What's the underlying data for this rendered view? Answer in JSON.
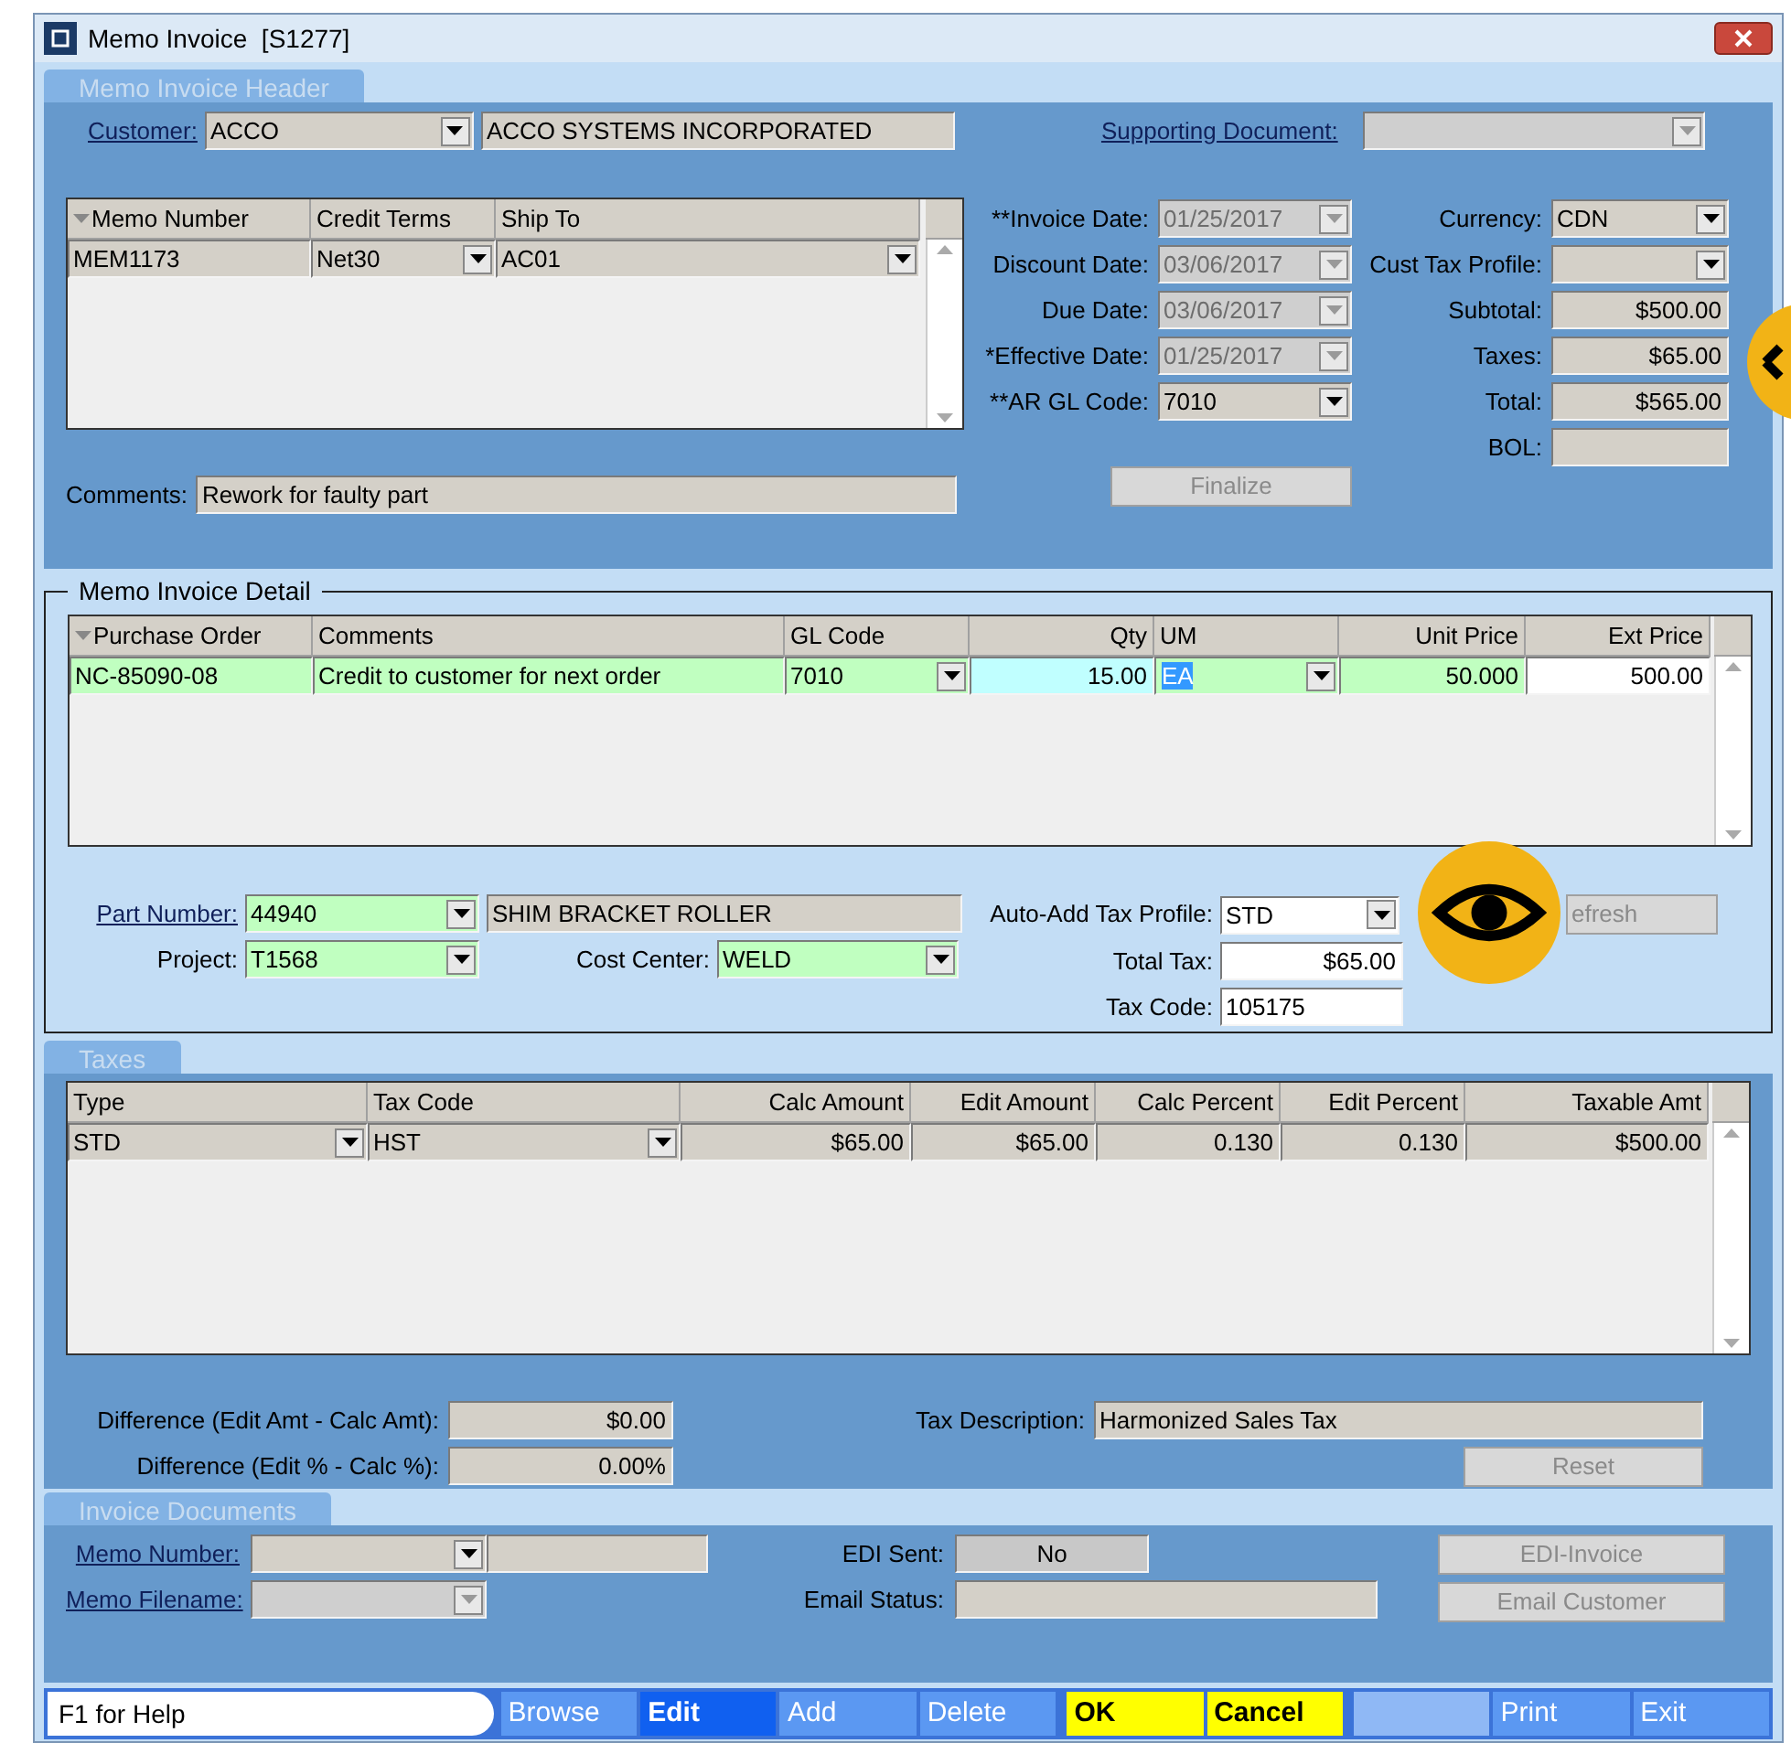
{
  "window": {
    "title": "Memo Invoice  [S1277]"
  },
  "header": {
    "title": "Memo Invoice Header",
    "customer": {
      "label": "Customer:",
      "link": true,
      "code": "ACCO",
      "name": "ACCO SYSTEMS INCORPORATED"
    },
    "supporting_document": {
      "label": "Supporting Document:",
      "link": true,
      "disabled": true
    },
    "memo_grid": {
      "columns": [
        {
          "label": "Memo Number",
          "kind": "text",
          "sort": true
        },
        {
          "label": "Credit Terms",
          "kind": "dropdown",
          "sort": false
        },
        {
          "label": "Ship To",
          "kind": "dropdown",
          "sort": false
        }
      ],
      "rows": [
        [
          "MEM1173",
          "Net30",
          "AC01"
        ]
      ]
    },
    "date_fields": [
      {
        "label": "**Invoice Date:",
        "value": "01/25/2017",
        "disabled": true
      },
      {
        "label": "Discount Date:",
        "value": "03/06/2017",
        "disabled": true
      },
      {
        "label": "Due Date:",
        "value": "03/06/2017",
        "disabled": true
      },
      {
        "label": "*Effective Date:",
        "value": "01/25/2017",
        "disabled": true
      },
      {
        "label": "**AR GL Code:",
        "value": "7010",
        "disabled": false
      }
    ],
    "totals": [
      {
        "label": "Currency:",
        "value": "CDN",
        "kind": "dropdown"
      },
      {
        "label": "Cust Tax Profile:",
        "kind": "dropdown"
      },
      {
        "label": "Subtotal:",
        "value": "$500.00",
        "kind": "readonly"
      },
      {
        "label": "Taxes:",
        "value": "$65.00",
        "kind": "readonly"
      },
      {
        "label": "Total:",
        "value": "$565.00",
        "kind": "readonly"
      },
      {
        "label": "BOL:",
        "kind": "readonly"
      }
    ],
    "comments": {
      "label": "Comments:",
      "value": "Rework for faulty part"
    },
    "finalize_button": {
      "label": "Finalize",
      "disabled": true
    }
  },
  "detail": {
    "title": "Memo Invoice Detail",
    "columns": [
      {
        "label": "Purchase Order",
        "kind": "text",
        "sort": true
      },
      {
        "label": "Comments",
        "kind": "text",
        "sort": false
      },
      {
        "label": "GL Code",
        "kind": "dropdown",
        "sort": false
      },
      {
        "label": "Qty",
        "kind": "number",
        "sort": false
      },
      {
        "label": "UM",
        "kind": "dropdown",
        "sort": false
      },
      {
        "label": "Unit Price",
        "kind": "number",
        "sort": false
      },
      {
        "label": "Ext Price",
        "kind": "number",
        "sort": false
      }
    ],
    "rows": [
      [
        {
          "value": "NC-85090-08",
          "color": "#c0ffc0"
        },
        {
          "value": "Credit to customer for next order",
          "color": "#c0ffc0"
        },
        {
          "value": "7010",
          "color": "#c0ffc0"
        },
        {
          "value": "15.00",
          "color": "#c0ffff"
        },
        {
          "value": "EA",
          "color": "#c0ffc0",
          "highlighted": true
        },
        {
          "value": "50.000",
          "color": "#c0ffc0"
        },
        {
          "value": "500.00",
          "color": "#ffffff"
        }
      ]
    ],
    "part_number": {
      "label": "Part Number:",
      "link": true,
      "value": "44940",
      "description": "SHIM BRACKET ROLLER"
    },
    "project": {
      "label": "Project:",
      "value": "T1568"
    },
    "cost_center": {
      "label": "Cost Center:",
      "value": "WELD"
    },
    "auto_add_tax_profile": {
      "label": "Auto-Add Tax Profile:",
      "value": "STD"
    },
    "total_tax": {
      "label": "Total Tax:",
      "value": "$65.00"
    },
    "tax_code": {
      "label": "Tax Code:",
      "value": "105175"
    },
    "refresh_button": {
      "label": "efresh",
      "disabled": true
    }
  },
  "taxes": {
    "title": "Taxes",
    "columns": [
      {
        "label": "Type",
        "kind": "dropdown"
      },
      {
        "label": "Tax Code",
        "kind": "dropdown"
      },
      {
        "label": "Calc Amount",
        "kind": "number"
      },
      {
        "label": "Edit Amount",
        "kind": "number"
      },
      {
        "label": "Calc Percent",
        "kind": "number"
      },
      {
        "label": "Edit Percent",
        "kind": "number"
      },
      {
        "label": "Taxable Amt",
        "kind": "number"
      }
    ],
    "rows": [
      [
        "STD",
        "HST",
        "$65.00",
        "$65.00",
        "0.130",
        "0.130",
        "$500.00"
      ]
    ],
    "difference_amount": {
      "label": "Difference (Edit Amt - Calc Amt):",
      "value": "$0.00"
    },
    "difference_percent": {
      "label": "Difference (Edit % - Calc %):",
      "value": "0.00%"
    },
    "tax_description": {
      "label": "Tax Description:",
      "value": "Harmonized Sales Tax"
    },
    "reset_button": {
      "label": "Reset",
      "disabled": true
    }
  },
  "invoice_documents": {
    "title": "Invoice Documents",
    "memo_number": {
      "label": "Memo Number:",
      "link": true,
      "disabled": false
    },
    "memo_filename": {
      "label": "Memo Filename:",
      "link": true,
      "disabled": true
    },
    "edi_sent": {
      "label": "EDI Sent:",
      "value": "No"
    },
    "email_status": {
      "label": "Email Status:"
    },
    "buttons": [
      {
        "label": "EDI-Invoice",
        "disabled": true
      },
      {
        "label": "Email Customer",
        "disabled": true
      }
    ]
  },
  "status_bar": {
    "help": "F1 for Help",
    "buttons": [
      {
        "label": "Browse",
        "kind": "nav",
        "selected": false
      },
      {
        "label": "Edit",
        "kind": "nav",
        "selected": true
      },
      {
        "label": "Add",
        "kind": "nav",
        "selected": false
      },
      {
        "label": "Delete",
        "kind": "nav",
        "selected": false
      },
      {
        "label": "OK",
        "kind": "confirm",
        "selected": false
      },
      {
        "label": "Cancel",
        "kind": "confirm",
        "selected": false
      },
      {
        "kind": "blank",
        "selected": false
      },
      {
        "label": "Print",
        "kind": "nav",
        "selected": false
      },
      {
        "label": "Exit",
        "kind": "nav",
        "selected": false
      }
    ]
  }
}
